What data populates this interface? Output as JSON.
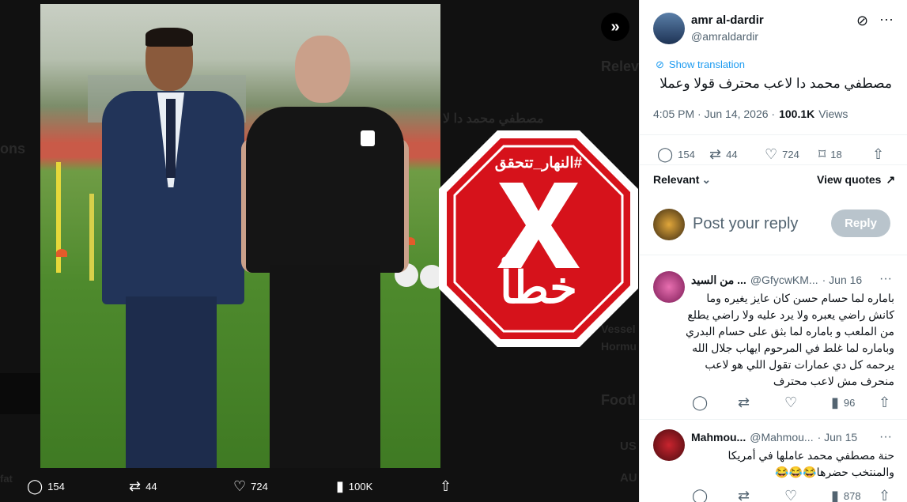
{
  "viewer": {
    "ghost_texts": [
      "Relev",
      "مصطفي محمد دا لا",
      "ons",
      "Vessel",
      "Hormu",
      "Footl",
      "US",
      "AU",
      "fat"
    ],
    "stop_sign": {
      "hashtag": "#النهار_تتحقق",
      "verdict": "خطأ",
      "color": "#d6121b"
    },
    "expand_icon": "double-chevron-right-icon",
    "actions": {
      "replies": "154",
      "reposts": "44",
      "likes": "724",
      "views": "100K"
    }
  },
  "tweet": {
    "author_name": "amr al-dardir",
    "author_handle": "@amraldardir",
    "show_translation": "Show translation",
    "text": "مصطفي محمد دا لاعب محترف قولا وعملا",
    "time": "4:05 PM · Jun 14, 2026 ·",
    "views_count": "100.1K",
    "views_label": "Views",
    "actions": {
      "replies": "154",
      "reposts": "44",
      "likes": "724",
      "bookmarks": "18"
    },
    "sort_label": "Relevant",
    "view_quotes": "View quotes"
  },
  "composer": {
    "placeholder": "Post your reply",
    "reply_label": "Reply"
  },
  "replies": [
    {
      "name": "من السيد ...",
      "handle": "@GfycwKM...",
      "date": "· Jun 16",
      "text": "باماره لما حسام حسن كان عايز يغيره وما كانش راضي يعبره ولا يرد عليه ولا راضي يطلع من الملعب و باماره لما بثق على حسام البدري وباماره لما غلط في المرحوم ايهاب جلال الله يرحمه كل دي عمارات تقول اللي هو لاعب منحرف مش لاعب محترف",
      "views": "96"
    },
    {
      "name": "Mahmou...",
      "handle": "@Mahmou...",
      "date": "· Jun 15",
      "text": "حنة مصطفي محمد عاملها في أمريكا والمنتخب حضرها😂😂😂",
      "views": "878"
    }
  ]
}
